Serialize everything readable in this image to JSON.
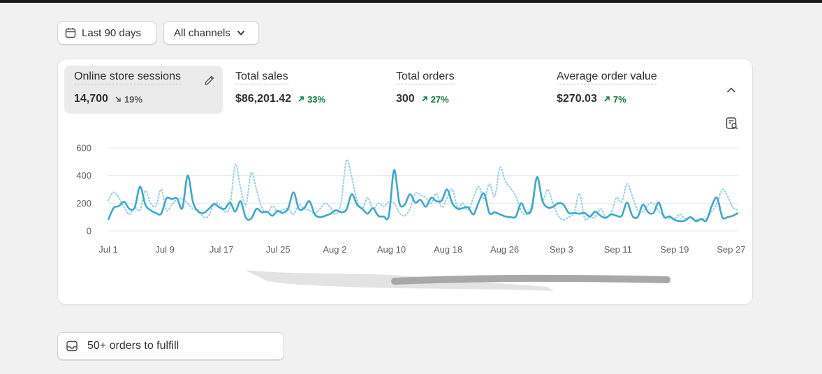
{
  "filters": {
    "date_range_label": "Last 90 days",
    "channel_label": "All channels"
  },
  "metrics": [
    {
      "label": "Online store sessions",
      "value": "14,700",
      "change": "19%",
      "direction": "down",
      "active": true
    },
    {
      "label": "Total sales",
      "value": "$86,201.42",
      "change": "33%",
      "direction": "up",
      "active": false
    },
    {
      "label": "Total orders",
      "value": "300",
      "change": "27%",
      "direction": "up",
      "active": false
    },
    {
      "label": "Average order value",
      "value": "$270.03",
      "change": "7%",
      "direction": "up",
      "active": false
    }
  ],
  "colors": {
    "accent_line": "#3aa8d0",
    "comparison_line": "#8fd0e6",
    "positive": "#0c7a43",
    "neutral_change": "#616161",
    "active_metric_bg": "#ebebeb",
    "gridline": "#e8e8e8"
  },
  "chart_data": {
    "type": "line",
    "title": "",
    "xlabel": "",
    "ylabel": "",
    "ylim": [
      0,
      600
    ],
    "yticks": [
      "600",
      "400",
      "200",
      "0"
    ],
    "xtick_labels": [
      "Jul 1",
      "Jul 9",
      "Jul 17",
      "Jul 25",
      "Aug 2",
      "Aug 10",
      "Aug 18",
      "Aug 26",
      "Sep 3",
      "Sep 11",
      "Sep 19",
      "Sep 27"
    ],
    "grid": true,
    "legend": "none",
    "series": [
      {
        "style": "solid",
        "values": [
          80,
          165,
          180,
          210,
          160,
          170,
          320,
          190,
          150,
          130,
          125,
          235,
          230,
          235,
          165,
          400,
          210,
          140,
          130,
          160,
          195,
          170,
          160,
          205,
          140,
          215,
          95,
          90,
          160,
          135,
          140,
          110,
          145,
          130,
          165,
          280,
          160,
          165,
          215,
          120,
          100,
          110,
          125,
          150,
          135,
          155,
          265,
          190,
          160,
          125,
          165,
          110,
          105,
          110,
          440,
          200,
          190,
          265,
          205,
          225,
          175,
          240,
          215,
          220,
          300,
          200,
          160,
          165,
          170,
          120,
          210,
          270,
          130,
          135,
          120,
          105,
          100,
          105,
          200,
          130,
          160,
          390,
          220,
          170,
          175,
          200,
          190,
          130,
          130,
          125,
          130,
          105,
          140,
          110,
          95,
          120,
          110,
          110,
          205,
          110,
          100,
          190,
          135,
          130,
          205,
          100,
          105,
          80,
          70,
          75,
          100,
          70,
          85,
          75,
          180,
          240,
          100,
          100,
          110,
          130
        ]
      },
      {
        "style": "dotted",
        "values": [
          220,
          280,
          240,
          170,
          120,
          170,
          150,
          290,
          200,
          180,
          300,
          150,
          190,
          230,
          230,
          200,
          160,
          150,
          100,
          110,
          200,
          190,
          140,
          180,
          480,
          310,
          190,
          420,
          300,
          170,
          130,
          180,
          140,
          155,
          160,
          120,
          190,
          160,
          150,
          125,
          160,
          200,
          170,
          120,
          210,
          510,
          390,
          220,
          160,
          240,
          160,
          200,
          175,
          210,
          200,
          130,
          110,
          160,
          270,
          260,
          240,
          200,
          270,
          170,
          240,
          300,
          170,
          200,
          150,
          240,
          320,
          230,
          340,
          250,
          460,
          360,
          310,
          250,
          145,
          120,
          190,
          380,
          220,
          300,
          200,
          110,
          80,
          100,
          130,
          270,
          90,
          100,
          100,
          160,
          100,
          130,
          240,
          210,
          340,
          250,
          150,
          140,
          190,
          200,
          140,
          110,
          90,
          90,
          120,
          90,
          100,
          80,
          90,
          90,
          140,
          200,
          300,
          250,
          170,
          150
        ]
      }
    ]
  },
  "fulfill": {
    "label": "50+ orders to fulfill"
  }
}
